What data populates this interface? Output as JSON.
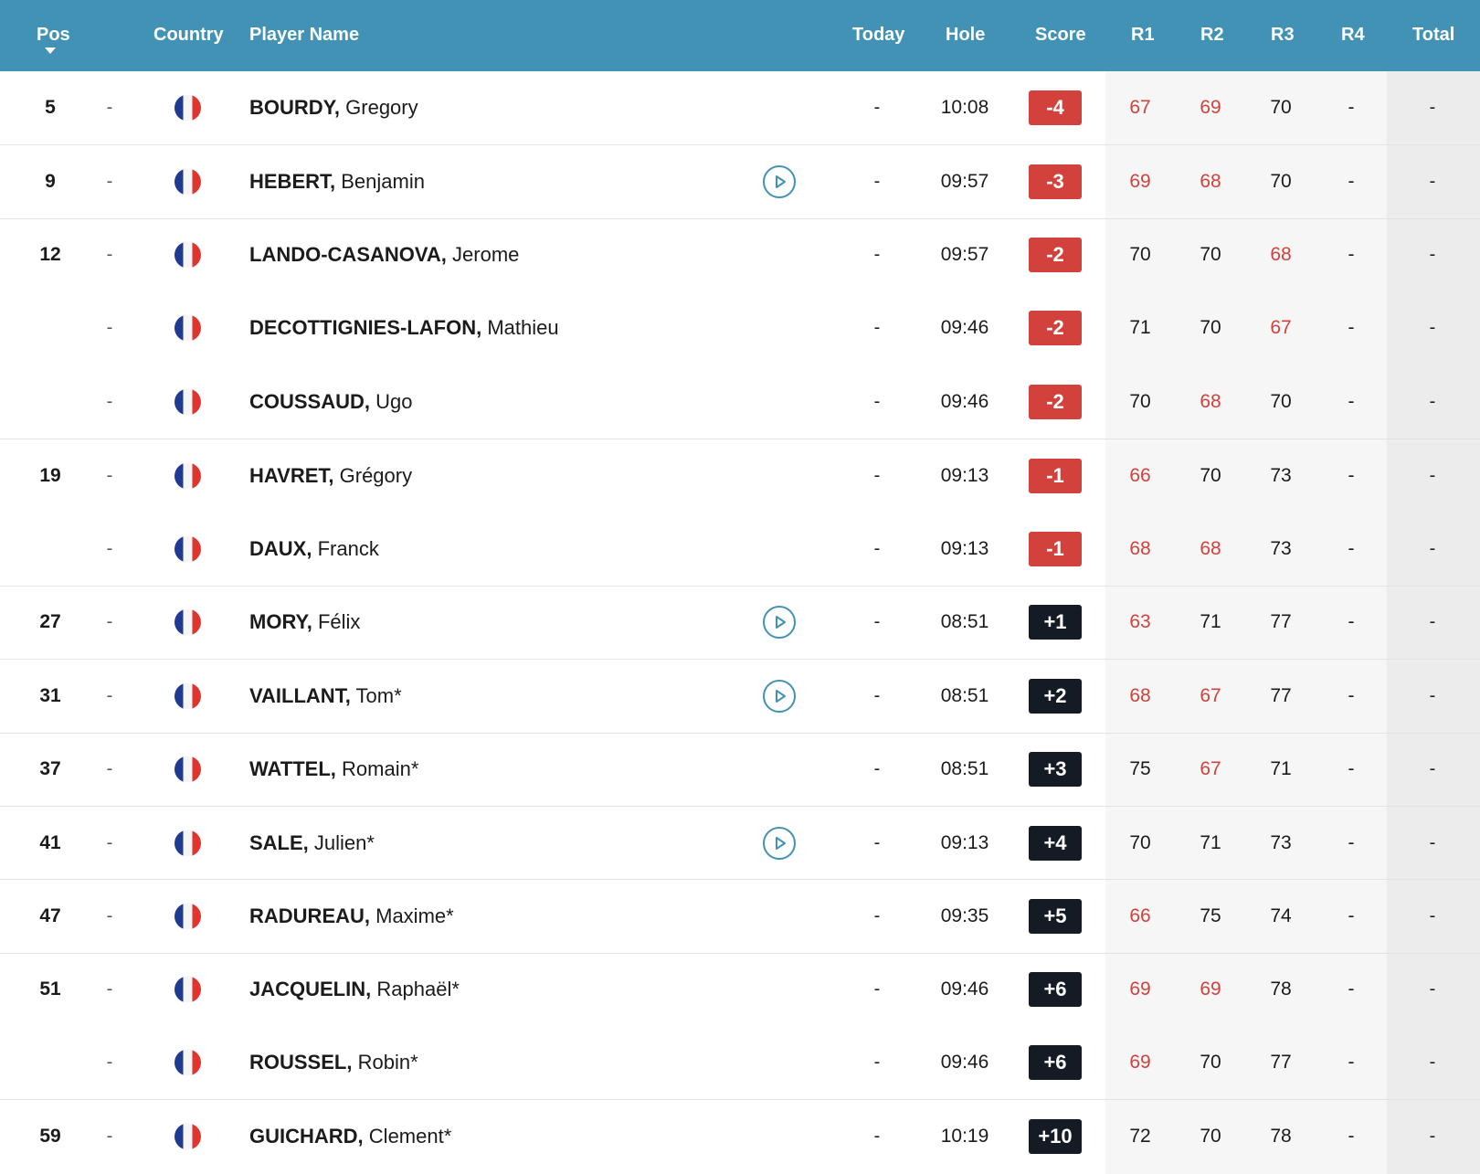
{
  "header": {
    "pos": "Pos",
    "country": "Country",
    "player": "Player Name",
    "today": "Today",
    "hole": "Hole",
    "score": "Score",
    "r1": "R1",
    "r2": "R2",
    "r3": "R3",
    "r4": "R4",
    "total": "Total"
  },
  "colors": {
    "header_bg": "#4192b4",
    "under_par": "#d2413c",
    "over_par": "#151b25"
  },
  "rows": [
    {
      "pos": "5",
      "move": "-",
      "country": "France",
      "last": "BOURDY,",
      "first": "Gregory",
      "video": false,
      "today": "-",
      "hole": "10:08",
      "score": "-4",
      "under": true,
      "r1": "67",
      "r2": "69",
      "r3": "70",
      "r4": "-",
      "total": "-",
      "red": [
        true,
        true,
        false
      ],
      "sep": false
    },
    {
      "pos": "9",
      "move": "-",
      "country": "France",
      "last": "HEBERT,",
      "first": "Benjamin",
      "video": true,
      "today": "-",
      "hole": "09:57",
      "score": "-3",
      "under": true,
      "r1": "69",
      "r2": "68",
      "r3": "70",
      "r4": "-",
      "total": "-",
      "red": [
        true,
        true,
        false
      ],
      "sep": true
    },
    {
      "pos": "12",
      "move": "-",
      "country": "France",
      "last": "LANDO-CASANOVA,",
      "first": "Jerome",
      "video": false,
      "today": "-",
      "hole": "09:57",
      "score": "-2",
      "under": true,
      "r1": "70",
      "r2": "70",
      "r3": "68",
      "r4": "-",
      "total": "-",
      "red": [
        false,
        false,
        true
      ],
      "sep": true
    },
    {
      "pos": "",
      "move": "-",
      "country": "France",
      "last": "DECOTTIGNIES-LAFON,",
      "first": "Mathieu",
      "video": false,
      "today": "-",
      "hole": "09:46",
      "score": "-2",
      "under": true,
      "r1": "71",
      "r2": "70",
      "r3": "67",
      "r4": "-",
      "total": "-",
      "red": [
        false,
        false,
        true
      ],
      "sep": false
    },
    {
      "pos": "",
      "move": "-",
      "country": "France",
      "last": "COUSSAUD,",
      "first": "Ugo",
      "video": false,
      "today": "-",
      "hole": "09:46",
      "score": "-2",
      "under": true,
      "r1": "70",
      "r2": "68",
      "r3": "70",
      "r4": "-",
      "total": "-",
      "red": [
        false,
        true,
        false
      ],
      "sep": false
    },
    {
      "pos": "19",
      "move": "-",
      "country": "France",
      "last": "HAVRET,",
      "first": "Grégory",
      "video": false,
      "today": "-",
      "hole": "09:13",
      "score": "-1",
      "under": true,
      "r1": "66",
      "r2": "70",
      "r3": "73",
      "r4": "-",
      "total": "-",
      "red": [
        true,
        false,
        false
      ],
      "sep": true
    },
    {
      "pos": "",
      "move": "-",
      "country": "France",
      "last": "DAUX,",
      "first": "Franck",
      "video": false,
      "today": "-",
      "hole": "09:13",
      "score": "-1",
      "under": true,
      "r1": "68",
      "r2": "68",
      "r3": "73",
      "r4": "-",
      "total": "-",
      "red": [
        true,
        true,
        false
      ],
      "sep": false
    },
    {
      "pos": "27",
      "move": "-",
      "country": "France",
      "last": "MORY,",
      "first": "Félix",
      "video": true,
      "today": "-",
      "hole": "08:51",
      "score": "+1",
      "under": false,
      "r1": "63",
      "r2": "71",
      "r3": "77",
      "r4": "-",
      "total": "-",
      "red": [
        true,
        false,
        false
      ],
      "sep": true
    },
    {
      "pos": "31",
      "move": "-",
      "country": "France",
      "last": "VAILLANT,",
      "first": "Tom*",
      "video": true,
      "today": "-",
      "hole": "08:51",
      "score": "+2",
      "under": false,
      "r1": "68",
      "r2": "67",
      "r3": "77",
      "r4": "-",
      "total": "-",
      "red": [
        true,
        true,
        false
      ],
      "sep": true
    },
    {
      "pos": "37",
      "move": "-",
      "country": "France",
      "last": "WATTEL,",
      "first": "Romain*",
      "video": false,
      "today": "-",
      "hole": "08:51",
      "score": "+3",
      "under": false,
      "r1": "75",
      "r2": "67",
      "r3": "71",
      "r4": "-",
      "total": "-",
      "red": [
        false,
        true,
        false
      ],
      "sep": true
    },
    {
      "pos": "41",
      "move": "-",
      "country": "France",
      "last": "SALE,",
      "first": "Julien*",
      "video": true,
      "today": "-",
      "hole": "09:13",
      "score": "+4",
      "under": false,
      "r1": "70",
      "r2": "71",
      "r3": "73",
      "r4": "-",
      "total": "-",
      "red": [
        false,
        false,
        false
      ],
      "sep": true
    },
    {
      "pos": "47",
      "move": "-",
      "country": "France",
      "last": "RADUREAU,",
      "first": "Maxime*",
      "video": false,
      "today": "-",
      "hole": "09:35",
      "score": "+5",
      "under": false,
      "r1": "66",
      "r2": "75",
      "r3": "74",
      "r4": "-",
      "total": "-",
      "red": [
        true,
        false,
        false
      ],
      "sep": true
    },
    {
      "pos": "51",
      "move": "-",
      "country": "France",
      "last": "JACQUELIN,",
      "first": "Raphaël*",
      "video": false,
      "today": "-",
      "hole": "09:46",
      "score": "+6",
      "under": false,
      "r1": "69",
      "r2": "69",
      "r3": "78",
      "r4": "-",
      "total": "-",
      "red": [
        true,
        true,
        false
      ],
      "sep": true
    },
    {
      "pos": "",
      "move": "-",
      "country": "France",
      "last": "ROUSSEL,",
      "first": "Robin*",
      "video": false,
      "today": "-",
      "hole": "09:46",
      "score": "+6",
      "under": false,
      "r1": "69",
      "r2": "70",
      "r3": "77",
      "r4": "-",
      "total": "-",
      "red": [
        true,
        false,
        false
      ],
      "sep": false
    },
    {
      "pos": "59",
      "move": "-",
      "country": "France",
      "last": "GUICHARD,",
      "first": "Clement*",
      "video": false,
      "today": "-",
      "hole": "10:19",
      "score": "+10",
      "under": false,
      "r1": "72",
      "r2": "70",
      "r3": "78",
      "r4": "-",
      "total": "-",
      "red": [
        false,
        false,
        false
      ],
      "sep": true
    }
  ]
}
